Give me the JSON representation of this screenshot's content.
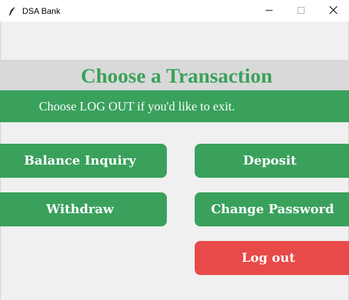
{
  "window": {
    "title": "DSA Bank",
    "icon": "feather-icon",
    "controls": [
      "minimize-icon",
      "maximize-icon",
      "close-icon"
    ]
  },
  "screen": {
    "heading": "Choose a Transaction",
    "subheading": "Choose LOG OUT if you'd like to exit."
  },
  "buttons": {
    "balance_inquiry": "Balance Inquiry",
    "deposit": "Deposit",
    "withdraw": "Withdraw",
    "change_password": "Change Password",
    "log_out": "Log out"
  },
  "colors": {
    "accent_green": "#3aa15c",
    "danger_red": "#e84a4a",
    "heading_band": "#d9d9d9",
    "background": "#f0f0f0"
  }
}
